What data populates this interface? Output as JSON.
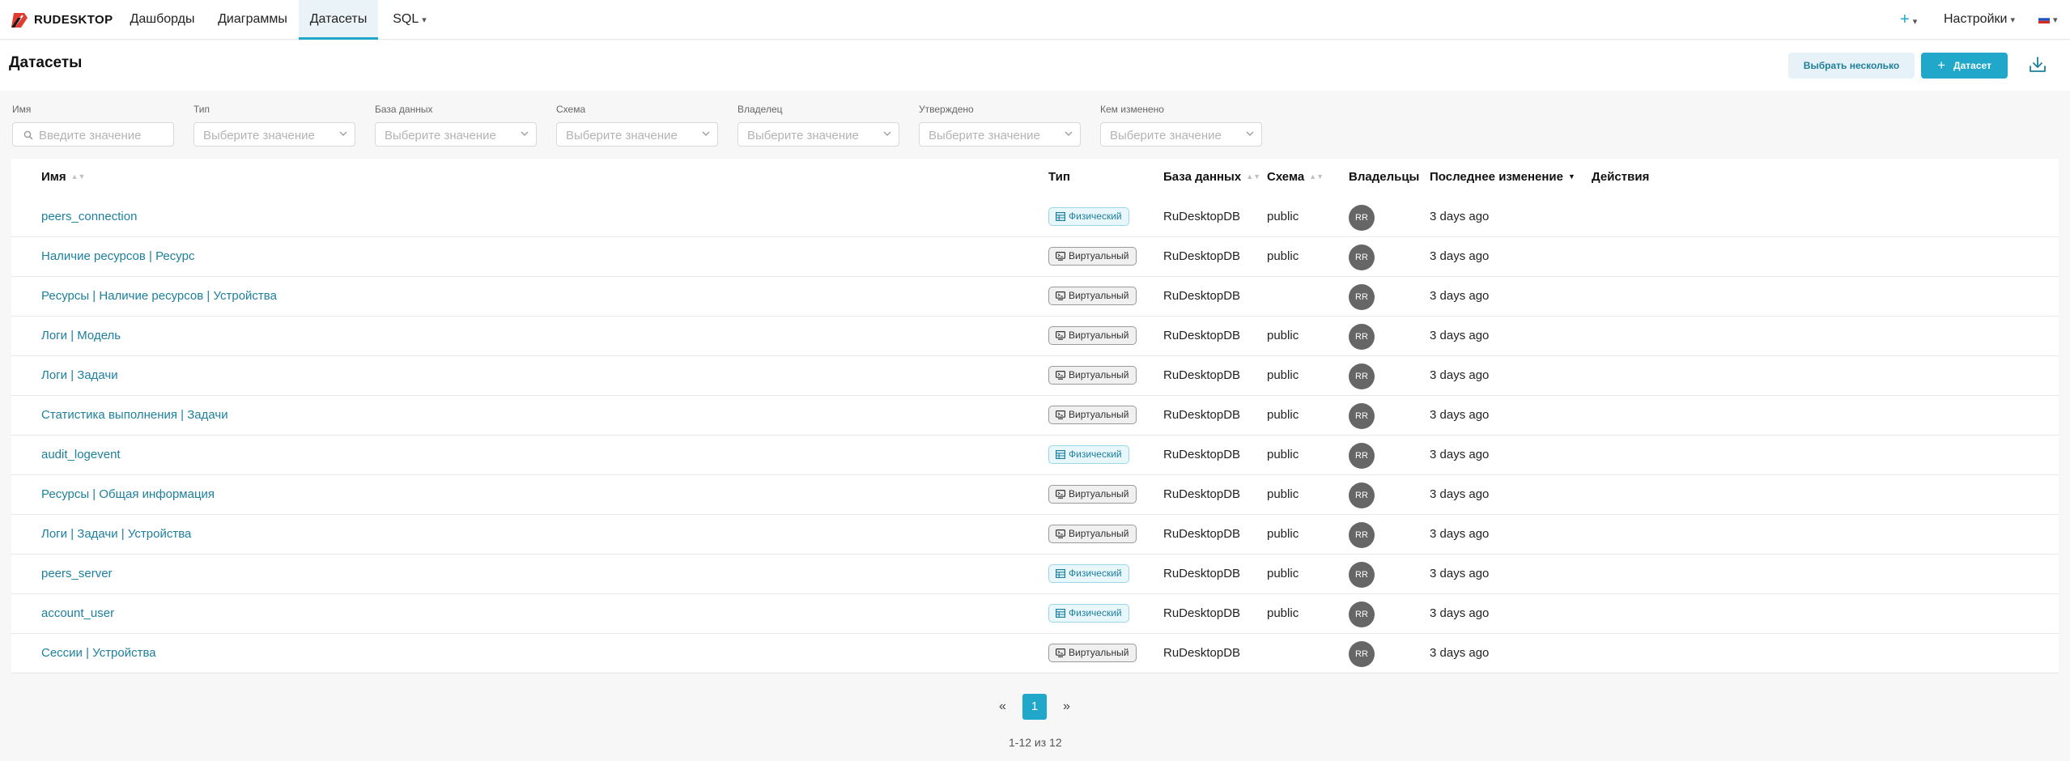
{
  "brand": {
    "name": "RUDESKTOP"
  },
  "nav": {
    "tabs": [
      {
        "label": "Дашборды"
      },
      {
        "label": "Диаграммы"
      },
      {
        "label": "Датасеты"
      },
      {
        "label": "SQL"
      }
    ],
    "active_tab": "Датасеты",
    "plus_label": "+",
    "settings_label": "Настройки",
    "language_flag": "russia-flag-icon"
  },
  "header": {
    "title": "Датасеты",
    "select_multiple_label": "Выбрать несколько",
    "add_dataset_label": "Датасет",
    "add_dataset_plus": "+"
  },
  "filters": [
    {
      "label": "Имя",
      "placeholder": "Введите значение",
      "kind": "search"
    },
    {
      "label": "Тип",
      "placeholder": "Выберите значение",
      "kind": "select"
    },
    {
      "label": "База данных",
      "placeholder": "Выберите значение",
      "kind": "select"
    },
    {
      "label": "Схема",
      "placeholder": "Выберите значение",
      "kind": "select"
    },
    {
      "label": "Владелец",
      "placeholder": "Выберите значение",
      "kind": "select"
    },
    {
      "label": "Утверждено",
      "placeholder": "Выберите значение",
      "kind": "select"
    },
    {
      "label": "Кем изменено",
      "placeholder": "Выберите значение",
      "kind": "select"
    }
  ],
  "table": {
    "columns": {
      "name": "Имя",
      "type": "Тип",
      "database": "База данных",
      "schema": "Схема",
      "owners": "Владельцы",
      "modified": "Последнее изменение",
      "actions": "Действия"
    },
    "sorted_by": "modified",
    "rows": [
      {
        "name": "peers_connection",
        "type": "Физический",
        "kind": "phys",
        "database": "RuDesktopDB",
        "schema": "public",
        "owner": "RR",
        "modified": "3 days ago"
      },
      {
        "name": "Наличие ресурсов | Ресурс",
        "type": "Виртуальный",
        "kind": "virt",
        "database": "RuDesktopDB",
        "schema": "public",
        "owner": "RR",
        "modified": "3 days ago"
      },
      {
        "name": "Ресурсы | Наличие ресурсов | Устройства",
        "type": "Виртуальный",
        "kind": "virt",
        "database": "RuDesktopDB",
        "schema": "",
        "owner": "RR",
        "modified": "3 days ago"
      },
      {
        "name": "Логи | Модель",
        "type": "Виртуальный",
        "kind": "virt",
        "database": "RuDesktopDB",
        "schema": "public",
        "owner": "RR",
        "modified": "3 days ago"
      },
      {
        "name": "Логи | Задачи",
        "type": "Виртуальный",
        "kind": "virt",
        "database": "RuDesktopDB",
        "schema": "public",
        "owner": "RR",
        "modified": "3 days ago"
      },
      {
        "name": "Статистика выполнения | Задачи",
        "type": "Виртуальный",
        "kind": "virt",
        "database": "RuDesktopDB",
        "schema": "public",
        "owner": "RR",
        "modified": "3 days ago"
      },
      {
        "name": "audit_logevent",
        "type": "Физический",
        "kind": "phys",
        "database": "RuDesktopDB",
        "schema": "public",
        "owner": "RR",
        "modified": "3 days ago"
      },
      {
        "name": "Ресурсы | Общая информация",
        "type": "Виртуальный",
        "kind": "virt",
        "database": "RuDesktopDB",
        "schema": "public",
        "owner": "RR",
        "modified": "3 days ago"
      },
      {
        "name": "Логи | Задачи | Устройства",
        "type": "Виртуальный",
        "kind": "virt",
        "database": "RuDesktopDB",
        "schema": "public",
        "owner": "RR",
        "modified": "3 days ago"
      },
      {
        "name": "peers_server",
        "type": "Физический",
        "kind": "phys",
        "database": "RuDesktopDB",
        "schema": "public",
        "owner": "RR",
        "modified": "3 days ago"
      },
      {
        "name": "account_user",
        "type": "Физический",
        "kind": "phys",
        "database": "RuDesktopDB",
        "schema": "public",
        "owner": "RR",
        "modified": "3 days ago"
      },
      {
        "name": "Сессии | Устройства",
        "type": "Виртуальный",
        "kind": "virt",
        "database": "RuDesktopDB",
        "schema": "",
        "owner": "RR",
        "modified": "3 days ago"
      }
    ]
  },
  "pagination": {
    "prev": "«",
    "current": "1",
    "next": "»",
    "summary": "1-12 из 12"
  },
  "colors": {
    "accent": "#20a7c9",
    "link": "#1d7f9d",
    "brand_red": "#e03c31"
  }
}
